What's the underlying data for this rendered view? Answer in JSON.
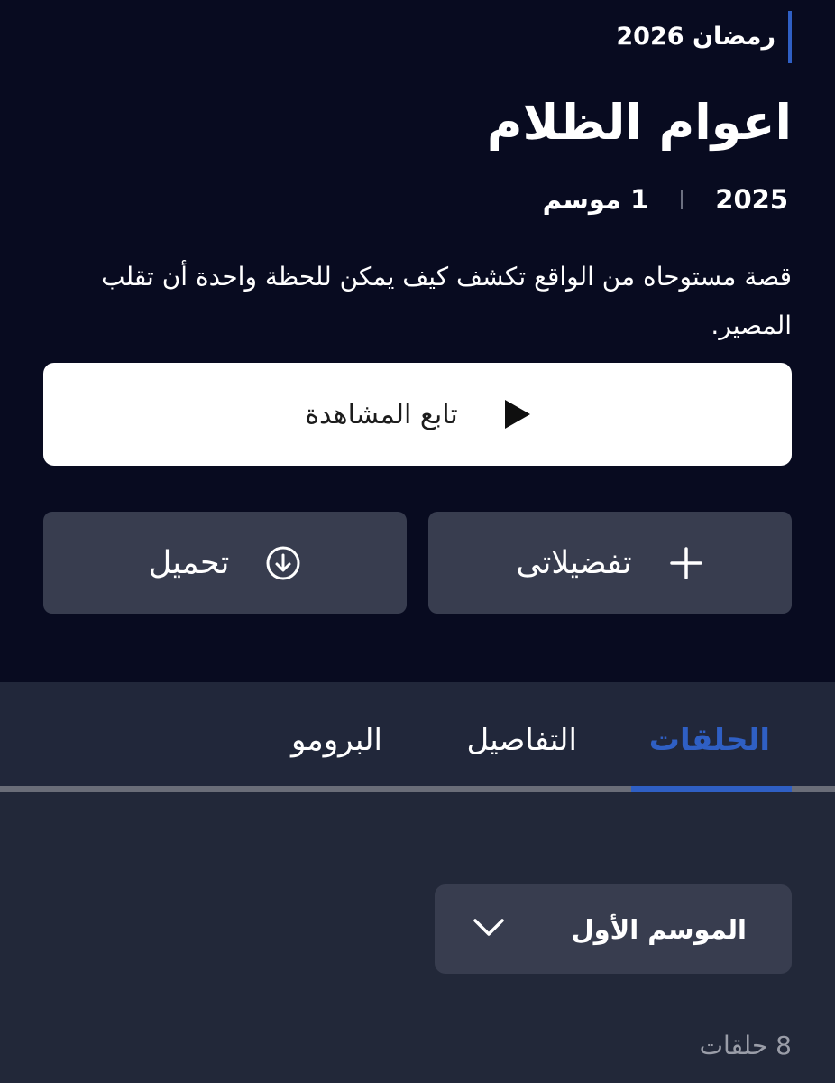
{
  "show": {
    "tag": "رمضان 2026",
    "title": "اعوام الظلام",
    "year": "2025",
    "seasons_count": "1 موسم",
    "description": "قصة مستوحاه من الواقع تكشف كيف يمكن للحظة واحدة أن تقلب المصير."
  },
  "actions": {
    "watch_label": "تابع المشاهدة",
    "favorites_label": "تفضيلاتى",
    "download_label": "تحميل"
  },
  "tabs": [
    {
      "label": "الحلقات",
      "active": true
    },
    {
      "label": "التفاصيل",
      "active": false
    },
    {
      "label": "البرومو",
      "active": false
    }
  ],
  "season_selector": {
    "selected": "الموسم الأول"
  },
  "episodes_count": "8 حلقات",
  "colors": {
    "accent": "#2f5fc4",
    "hero_bg": "#080b20",
    "page_bg": "#222839",
    "button_secondary_bg": "#383d4f"
  },
  "icons": [
    "play-icon",
    "plus-icon",
    "download-icon",
    "chevron-down-icon"
  ]
}
